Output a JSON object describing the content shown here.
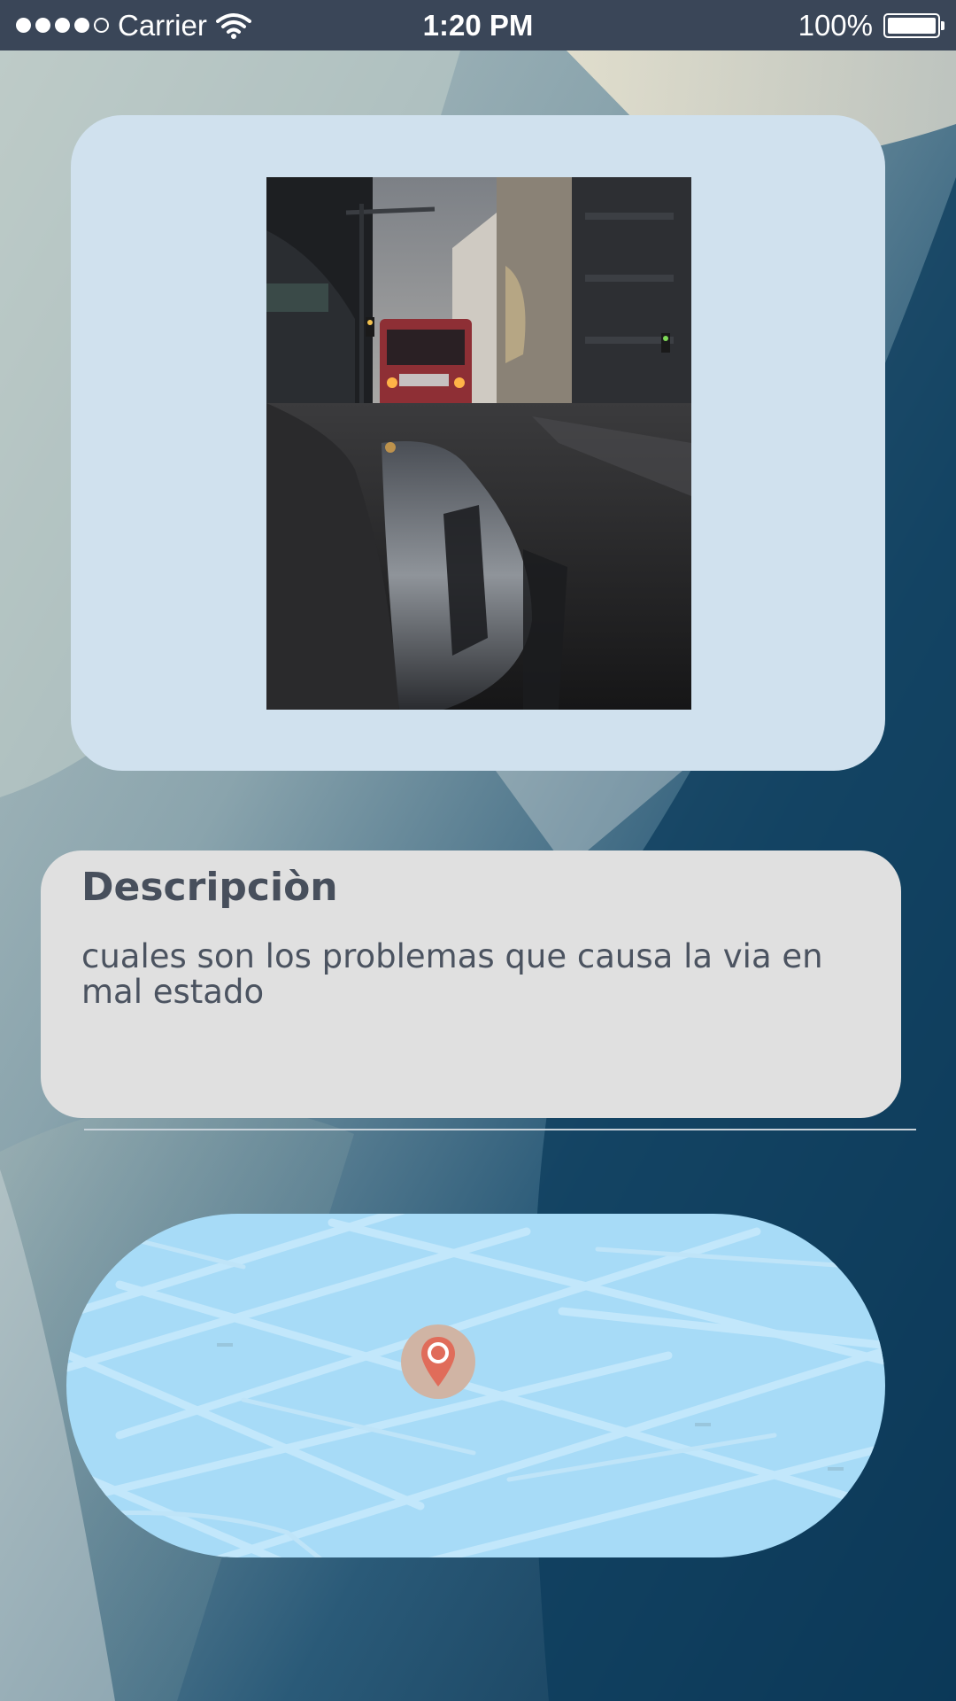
{
  "status_bar": {
    "carrier": "Carrier",
    "time": "1:20 PM",
    "battery": "100%",
    "battery_level": 1.0,
    "signal_bars_filled": 4,
    "signal_bars_total": 5
  },
  "photo": {
    "icon": "street-photo",
    "description_colors": {
      "card_bg": "#d0e1ee"
    }
  },
  "description": {
    "title": "Descripciòn",
    "text": "cuales son los problemas que causa la via en mal estado"
  },
  "map": {
    "icon": "location-pin-icon",
    "bg_color": "#a7dbf7",
    "pin_color": "#e06c5a"
  }
}
